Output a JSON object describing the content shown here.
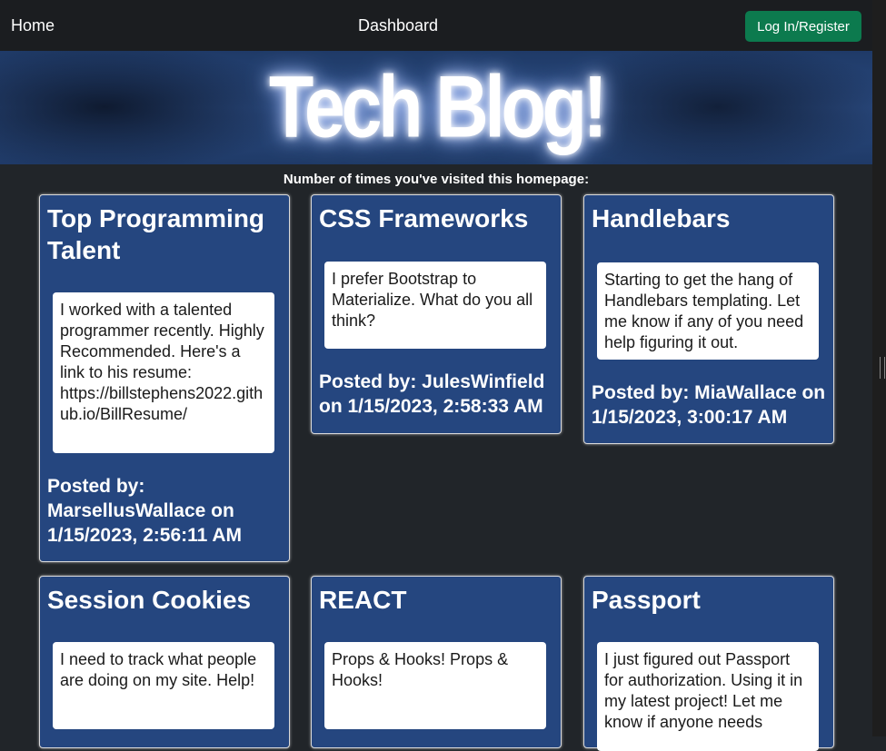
{
  "nav": {
    "home": "Home",
    "dashboard": "Dashboard",
    "login": "Log In/Register"
  },
  "hero": {
    "title": "Tech Blog!"
  },
  "visits": {
    "label": "Number of times you've visited this homepage:"
  },
  "posts": [
    {
      "title": "Top Programming Talent",
      "body": "I worked with a talented programmer recently. Highly Recommended. Here's a link to his resume: https://billstephens2022.github.io/BillResume/",
      "footer": "Posted by: MarsellusWallace on 1/15/2023, 2:56:11 AM"
    },
    {
      "title": "CSS Frameworks",
      "body": "I prefer Bootstrap to Materialize. What do you all think?",
      "footer": "Posted by: JulesWinfield on 1/15/2023, 2:58:33 AM"
    },
    {
      "title": "Handlebars",
      "body": "Starting to get the hang of Handlebars templating. Let me know if any of you need help figuring it out.",
      "footer": "Posted by: MiaWallace on 1/15/2023, 3:00:17 AM"
    },
    {
      "title": "Session Cookies",
      "body": "I need to track what people are doing on my site. Help!",
      "footer": ""
    },
    {
      "title": "REACT",
      "body": "Props & Hooks! Props & Hooks!",
      "footer": ""
    },
    {
      "title": "Passport",
      "body": "I just figured out Passport for authorization. Using it in my latest project! Let me know if anyone needs",
      "footer": ""
    }
  ]
}
